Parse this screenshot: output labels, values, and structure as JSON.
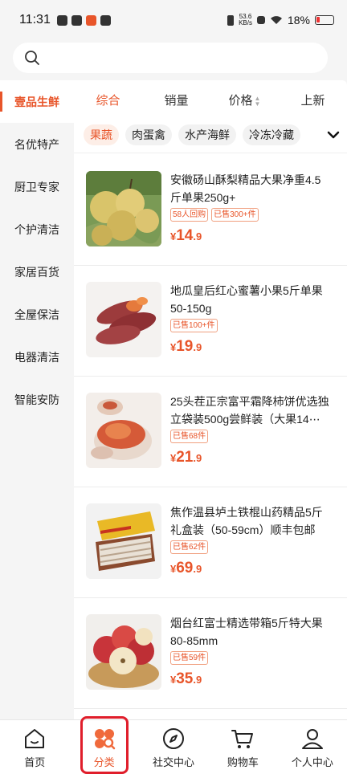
{
  "status_bar": {
    "time": "11:31",
    "net_speed_value": "53.6",
    "net_speed_unit": "KB/s",
    "battery": "18%"
  },
  "search": {
    "placeholder": ""
  },
  "sidebar": {
    "items": [
      {
        "label": "壹品生鲜",
        "active": true
      },
      {
        "label": "名优特产"
      },
      {
        "label": "厨卫专家"
      },
      {
        "label": "个护清洁"
      },
      {
        "label": "家居百货"
      },
      {
        "label": "全屋保洁"
      },
      {
        "label": "电器清洁"
      },
      {
        "label": "智能安防"
      }
    ]
  },
  "sort": {
    "items": [
      {
        "label": "综合",
        "active": true
      },
      {
        "label": "销量"
      },
      {
        "label": "价格"
      },
      {
        "label": "上新"
      }
    ]
  },
  "chips": [
    {
      "label": "果蔬",
      "active": true
    },
    {
      "label": "肉蛋禽"
    },
    {
      "label": "水产海鲜"
    },
    {
      "label": "冷冻冷藏"
    }
  ],
  "products": [
    {
      "title": "安徽砀山酥梨精品大果净重4.5斤单果250g+",
      "tags": [
        "58人回购",
        "已售300+件"
      ],
      "currency": "¥",
      "price_int": "14",
      "price_dec": ".9"
    },
    {
      "title": "地瓜皇后红心蜜薯小果5斤单果50-150g",
      "tags": [
        "已售100+件"
      ],
      "currency": "¥",
      "price_int": "19",
      "price_dec": ".9"
    },
    {
      "title": "25头茬正宗富平霜降柿饼优选独立袋装500g尝鲜装（大果14⋯",
      "tags": [
        "已售68件"
      ],
      "currency": "¥",
      "price_int": "21",
      "price_dec": ".9"
    },
    {
      "title": "焦作温县垆土铁棍山药精品5斤礼盒装（50-59cm）顺丰包邮",
      "tags": [
        "已售62件"
      ],
      "currency": "¥",
      "price_int": "69",
      "price_dec": ".9"
    },
    {
      "title": "烟台红富士精选带箱5斤特大果80-85mm",
      "tags": [
        "已售59件"
      ],
      "currency": "¥",
      "price_int": "35",
      "price_dec": ".9"
    }
  ],
  "tabbar": {
    "items": [
      {
        "label": "首页",
        "icon": "home-icon"
      },
      {
        "label": "分类",
        "icon": "category-icon",
        "active": true
      },
      {
        "label": "社交中心",
        "icon": "compass-icon"
      },
      {
        "label": "购物车",
        "icon": "cart-icon"
      },
      {
        "label": "个人中心",
        "icon": "user-icon"
      }
    ]
  },
  "colors": {
    "accent": "#e8552a",
    "highlight_box": "#e01e2b"
  }
}
